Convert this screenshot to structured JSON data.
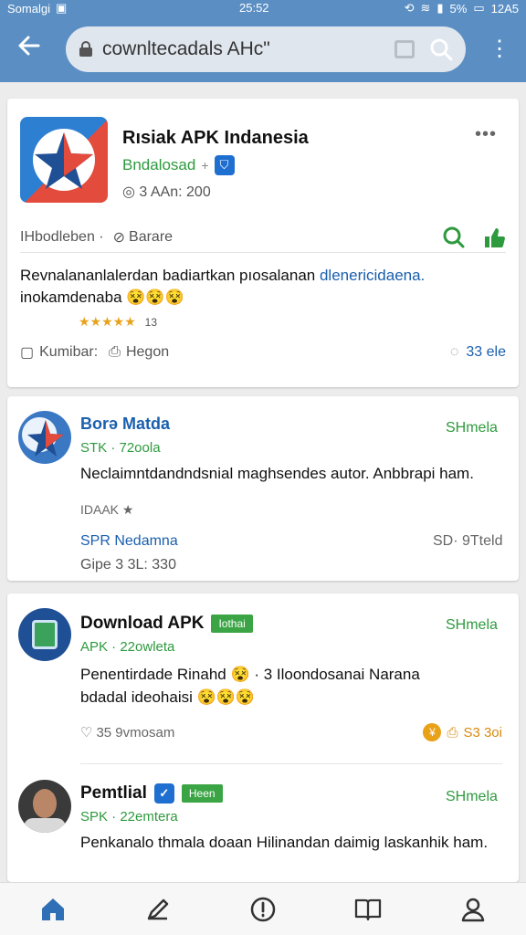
{
  "status_bar": {
    "carrier": "Somalgi",
    "time": "25:52",
    "battery": "5%",
    "right_text": "12A5"
  },
  "browser": {
    "url": "cownltecadals AHc\"",
    "back_icon": "arrow-left-icon",
    "menu_icon": "more-vertical-icon"
  },
  "cards": {
    "featured": {
      "title": "Rısiak APK Indanesia",
      "subtitle": "Bndalosad",
      "age": "3 AAn: 200",
      "meta_left": "IHbodleben ·",
      "meta_mid": "Barare",
      "description_main": "Revnalananlalerdan badiartkan pıosalanan ",
      "description_link": "dlenericidaena.",
      "description_line2": "inokamdenaba",
      "stars": "★★★★★",
      "rating_count": "13",
      "foot_left": "Kumibar:",
      "foot_mid": "Hegon",
      "comments": "33 ele"
    },
    "post1": {
      "name": "Borə Matda",
      "share": "SHmela",
      "subline": "STK · 72oola",
      "description": "Neclaimntdandndsnial maghsendes autor. Anbbrapi ham.",
      "small": "IDAAK ★",
      "link": "SPR Nedamna",
      "right_meta": "SD· 9Tteld",
      "size": "Gipe 3 3L: 330"
    },
    "post2": {
      "name": "Download APK",
      "tag": "Iothai",
      "share": "SHmela",
      "subline": "APK · 22owleta",
      "description_line1": "Penentirdade Rinahd 😵 · 3 Iloondosanai Narana",
      "description_line2": "bdadal ideohaisi 😵😵😵",
      "foot_left": "35 9vmosam",
      "foot_right": "S3 3oi",
      "coin_glyph": "¥"
    },
    "post3": {
      "name": "Pemtlial",
      "tag": "Heen",
      "share": "SHmela",
      "subline": "SPK · 22emtera",
      "description": "Penkanalo thmala doaan Hilinandan daimig laskanhik ham."
    }
  },
  "bottom_nav": [
    "home-icon",
    "edit-icon",
    "alert-circle-icon",
    "book-icon",
    "user-icon"
  ],
  "colors": {
    "appbar": "#5b8fc4",
    "accent_blue": "#1a5fae",
    "accent_green": "#2e9a3e",
    "star": "#e7a21a"
  }
}
